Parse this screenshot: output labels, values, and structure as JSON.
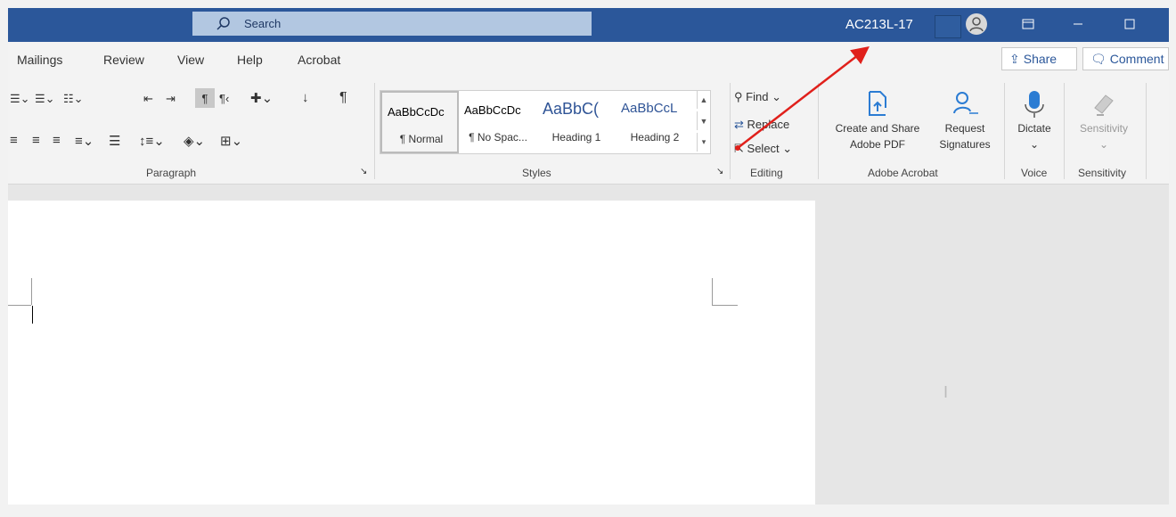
{
  "titlebar": {
    "search_label": "Search",
    "user_name": "AC213L-17",
    "bg_color": "#2b579a"
  },
  "menu": {
    "tabs": [
      "Mailings",
      "Review",
      "View",
      "Help",
      "Acrobat"
    ],
    "share_label": "Share",
    "comments_label": "Comment"
  },
  "ribbon": {
    "groups": {
      "paragraph": "Paragraph",
      "styles": "Styles",
      "editing": "Editing",
      "adobe": "Adobe Acrobat",
      "voice": "Voice",
      "sensitivity": "Sensitivity"
    },
    "styles": [
      {
        "preview": "AaBbCcDc",
        "name": "¶ Normal"
      },
      {
        "preview": "AaBbCcDc",
        "name": "¶ No Spac..."
      },
      {
        "preview": "AaBbC(",
        "name": "Heading 1"
      },
      {
        "preview": "AaBbCcL",
        "name": "Heading 2"
      }
    ],
    "editing": {
      "find": "Find",
      "replace": "Replace",
      "select": "Select"
    },
    "adobe": {
      "create_line1": "Create and Share",
      "create_line2": "Adobe PDF",
      "request_line1": "Request",
      "request_line2": "Signatures"
    },
    "voice": {
      "dictate": "Dictate"
    },
    "sensitivity": {
      "label": "Sensitivity"
    }
  },
  "colors": {
    "accent": "#2b579a",
    "arrow": "#e0201b"
  }
}
